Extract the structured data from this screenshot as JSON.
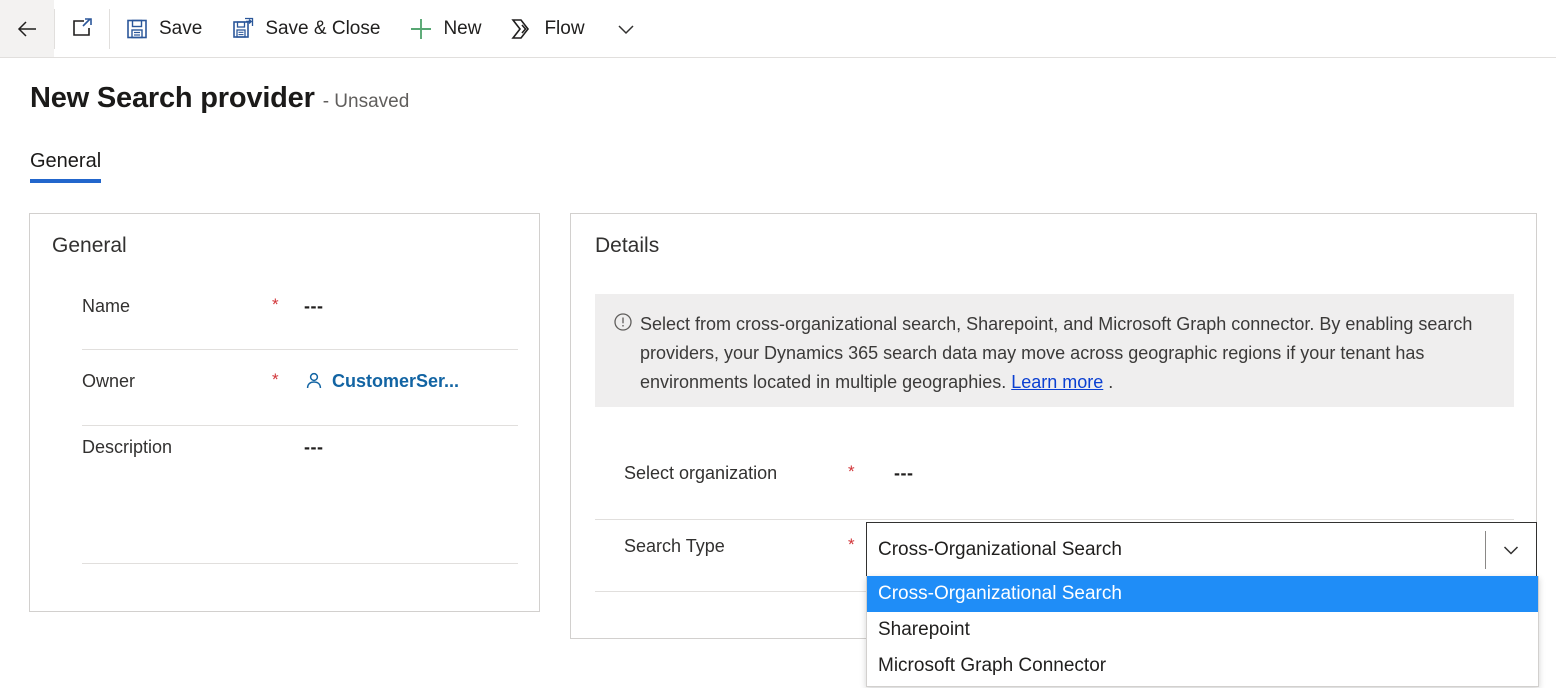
{
  "commandbar": {
    "items": [
      {
        "icon": "back-arrow-icon",
        "label": ""
      },
      {
        "icon": "open-in-new-window-icon",
        "label": ""
      },
      {
        "icon": "save-icon",
        "label": "Save"
      },
      {
        "icon": "save-and-close-icon",
        "label": "Save & Close"
      },
      {
        "icon": "plus-icon",
        "label": "New"
      },
      {
        "icon": "flow-icon",
        "label": "Flow"
      },
      {
        "icon": "chevron-down-icon",
        "label": ""
      }
    ],
    "save_label": "Save",
    "save_close_label": "Save & Close",
    "new_label": "New",
    "flow_label": "Flow"
  },
  "header": {
    "title": "New Search provider",
    "status": "- Unsaved"
  },
  "tabs": [
    {
      "label": "General",
      "selected": true
    }
  ],
  "general_card": {
    "title": "General",
    "fields": [
      {
        "label": "Name",
        "required": "*",
        "value": "---",
        "type": "text"
      },
      {
        "label": "Owner",
        "required": "*",
        "value": "CustomerSer...",
        "type": "lookup",
        "icon": "person-icon"
      },
      {
        "label": "Description",
        "required": "",
        "value": "---",
        "type": "text"
      }
    ]
  },
  "details_card": {
    "title": "Details",
    "info": {
      "icon": "info-circle-icon",
      "text_before_link": "Select from cross-organizational search, Sharepoint, and Microsoft Graph connector. By enabling search providers, your Dynamics 365 search data may move across geographic regions if your tenant has environments located in multiple geographies. ",
      "link_label": "Learn more",
      "text_after_link": " ."
    },
    "fields": [
      {
        "label": "Select organization",
        "required": "*",
        "value": "---"
      },
      {
        "label": "Search Type",
        "required": "*",
        "value": "Cross-Organizational Search"
      }
    ]
  },
  "search_type_combobox": {
    "value": "Cross-Organizational Search",
    "expanded": true,
    "options": [
      {
        "label": "Cross-Organizational Search",
        "selected": true
      },
      {
        "label": "Sharepoint",
        "selected": false
      },
      {
        "label": "Microsoft Graph Connector",
        "selected": false
      }
    ]
  },
  "colors": {
    "accent_blue": "#2266cc",
    "link_blue": "#1264a3",
    "required_red": "#d13438",
    "new_green": "#57a773",
    "save_blue": "#2b579a",
    "highlight_blue": "#1f8df7",
    "info_bg": "#efeeee"
  }
}
